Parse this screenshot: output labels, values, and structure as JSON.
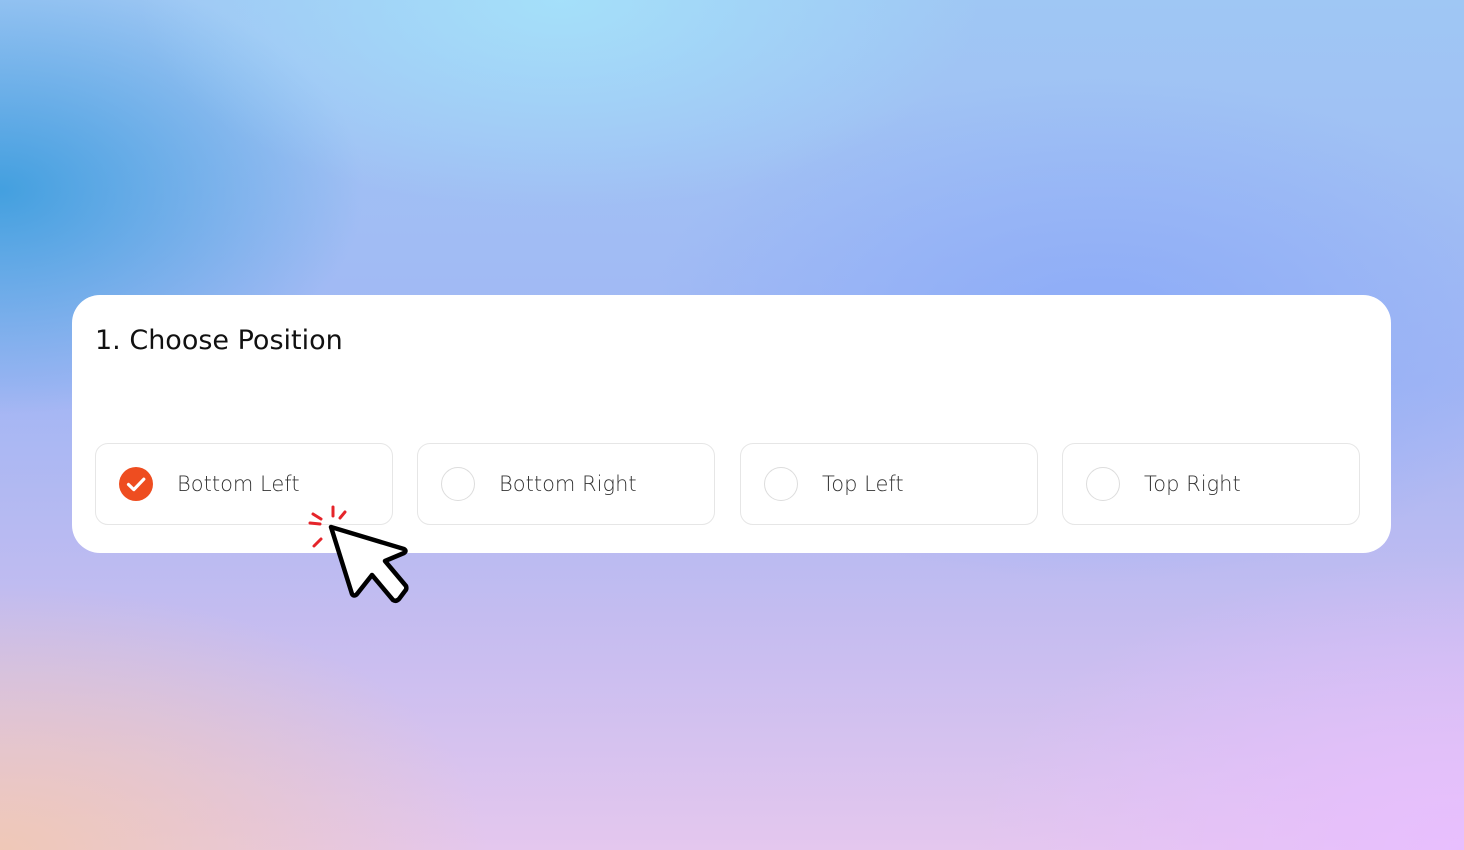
{
  "section": {
    "title": "1. Choose Position"
  },
  "options": [
    {
      "label": "Bottom Left",
      "selected": true
    },
    {
      "label": "Bottom Right",
      "selected": false
    },
    {
      "label": "Top Left",
      "selected": false
    },
    {
      "label": "Top Right",
      "selected": false
    }
  ],
  "colors": {
    "accent": "#ee4d20",
    "card": "#ffffff",
    "click_burst": "#e5242a"
  },
  "icons": {
    "selected": "checkmark-icon",
    "cursor": "mouse-pointer-icon",
    "click": "click-burst-icon"
  }
}
